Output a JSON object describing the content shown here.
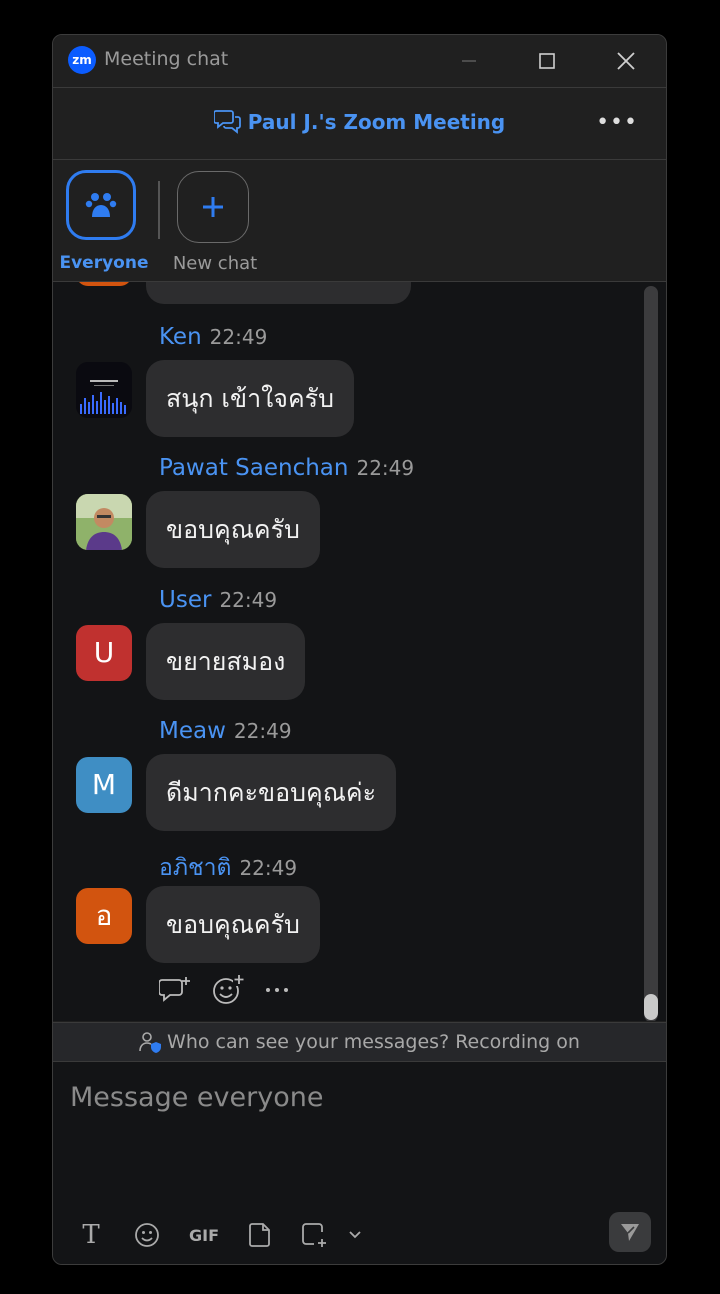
{
  "window": {
    "title": "Meeting chat",
    "logo_text": "zm"
  },
  "header": {
    "meeting_title": "Paul J.'s Zoom Meeting",
    "more": "…"
  },
  "tabs": [
    {
      "label": "Everyone",
      "icon": "group-icon",
      "active": true
    },
    {
      "label": "New chat",
      "icon": "plus-icon",
      "active": false
    }
  ],
  "messages": [
    {
      "sender": "Ken",
      "time": "22:49",
      "text": "สนุก เข้าใจครับ",
      "avatar": "image"
    },
    {
      "sender": "Pawat Saenchan",
      "time": "22:49",
      "text": "ขอบคุณครับ",
      "avatar": "photo"
    },
    {
      "sender": "User",
      "time": "22:49",
      "text": "ขยายสมอง",
      "avatar_letter": "U",
      "avatar_color": "#c0312f"
    },
    {
      "sender": "Meaw",
      "time": "22:49",
      "text": "ดีมากคะขอบคุณค่ะ",
      "avatar_letter": "M",
      "avatar_color": "#3f8ec4"
    },
    {
      "sender": "อภิชาติ",
      "time": "22:49",
      "text": "ขอบคุณครับ",
      "avatar_letter": "อ",
      "avatar_color": "#d2540f"
    }
  ],
  "notice": "Who can see your messages? Recording on",
  "composer": {
    "placeholder": "Message everyone",
    "gif_label": "GIF",
    "format_label": "T"
  },
  "colors": {
    "accent": "#4a93f2",
    "active_border": "#2f7cf0"
  }
}
